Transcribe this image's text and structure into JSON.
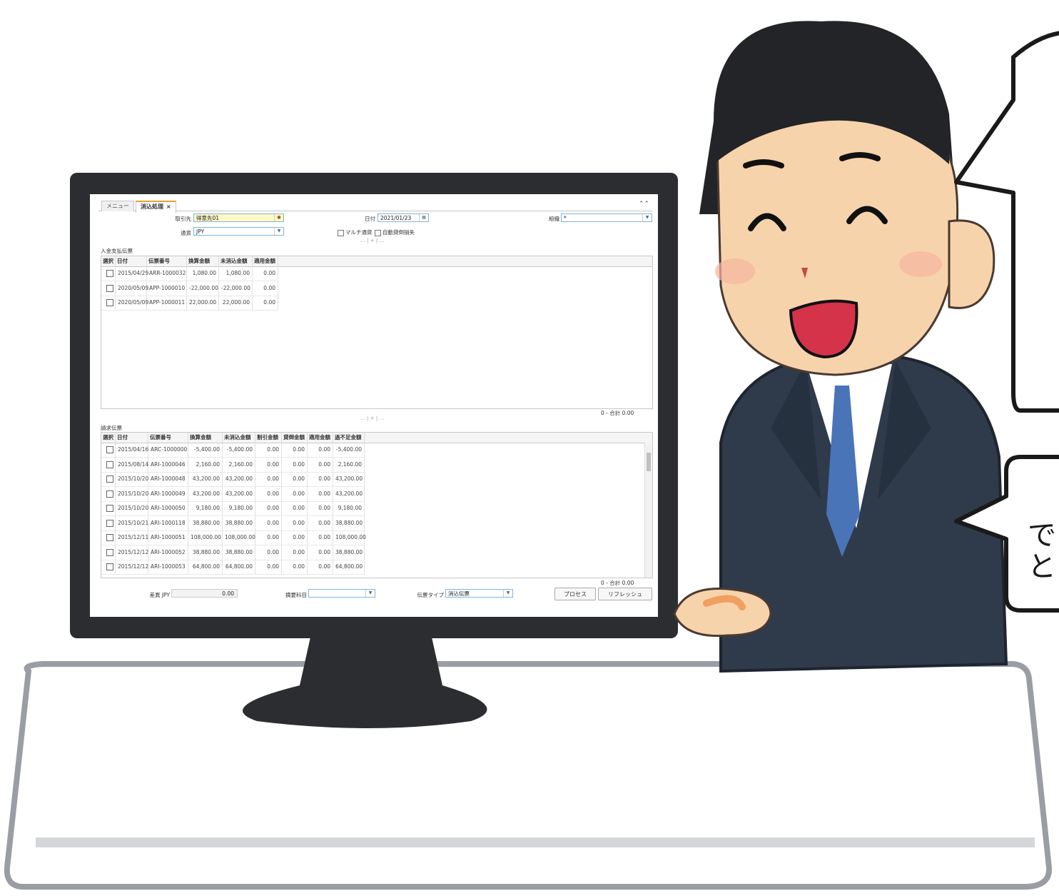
{
  "tabs": [
    {
      "label": "メニュー"
    },
    {
      "label": "消込処理",
      "close": "×"
    }
  ],
  "collapse_icon": "double-chevron-up",
  "form": {
    "partner_label": "取引先",
    "partner_value": "得意先01",
    "currency_label": "通貨",
    "currency_value": "JPY",
    "date_label": "日付",
    "date_value": "2021/01/23",
    "org_label": "組織",
    "org_value": "*",
    "multi_currency_label": "マルチ通貨",
    "auto_writeoff_label": "自動貸倒損失",
    "separator": "… | + | …"
  },
  "payments": {
    "title": "入金支払伝票",
    "columns": [
      "選択",
      "日付",
      "伝票番号",
      "換算金額",
      "未消込金額",
      "適用金額"
    ],
    "rows": [
      [
        "",
        "2015/04/29",
        "ARR-1000032",
        "1,080.00",
        "1,080.00",
        "0.00"
      ],
      [
        "",
        "2020/05/09",
        "APP-1000010",
        "-22,000.00",
        "-22,000.00",
        "0.00"
      ],
      [
        "",
        "2020/05/09",
        "APP-1000011",
        "22,000.00",
        "22,000.00",
        "0.00"
      ]
    ],
    "total": "0 - 合計 0.00"
  },
  "separator2": "… | + | …",
  "invoices": {
    "title": "請求伝票",
    "columns": [
      "選択",
      "日付",
      "伝票番号",
      "換算金額",
      "未消込金額",
      "割引金額",
      "貸倒金額",
      "適用金額",
      "過不足金額"
    ],
    "rows": [
      [
        "",
        "2015/04/16",
        "ARC-1000000",
        "-5,400.00",
        "-5,400.00",
        "0.00",
        "0.00",
        "0.00",
        "-5,400.00"
      ],
      [
        "",
        "2015/08/14",
        "ARI-1000046",
        "2,160.00",
        "2,160.00",
        "0.00",
        "0.00",
        "0.00",
        "2,160.00"
      ],
      [
        "",
        "2015/10/20",
        "ARI-1000048",
        "43,200.00",
        "43,200.00",
        "0.00",
        "0.00",
        "0.00",
        "43,200.00"
      ],
      [
        "",
        "2015/10/20",
        "ARI-1000049",
        "43,200.00",
        "43,200.00",
        "0.00",
        "0.00",
        "0.00",
        "43,200.00"
      ],
      [
        "",
        "2015/10/20",
        "ARI-1000050",
        "9,180.00",
        "9,180.00",
        "0.00",
        "0.00",
        "0.00",
        "9,180.00"
      ],
      [
        "",
        "2015/10/21",
        "ARI-1000118",
        "38,880.00",
        "38,880.00",
        "0.00",
        "0.00",
        "0.00",
        "38,880.00"
      ],
      [
        "",
        "2015/12/11",
        "ARI-1000051",
        "108,000.00",
        "108,000.00",
        "0.00",
        "0.00",
        "0.00",
        "108,000.00"
      ],
      [
        "",
        "2015/12/12",
        "ARI-1000052",
        "38,880.00",
        "38,880.00",
        "0.00",
        "0.00",
        "0.00",
        "38,880.00"
      ],
      [
        "",
        "2015/12/12",
        "ARI-1000053",
        "64,800.00",
        "64,800.00",
        "0.00",
        "0.00",
        "0.00",
        "64,800.00"
      ]
    ],
    "total": "0 - 合計 0.00"
  },
  "footer": {
    "diff_label": "差異 JPY",
    "diff_value": "0.00",
    "summary_label": "摘要科目",
    "summary_value": "",
    "doctype_label": "伝票タイプ",
    "doctype_value": "消込伝票",
    "process_button": "プロセス",
    "refresh_button": "リフレッシュ"
  },
  "bubble2": {
    "line1": "で",
    "line2": "と"
  },
  "colors": {
    "active_tab_accent": "#f0a030",
    "input_border": "#7fb4e0",
    "partner_field_bg": "#fff8c4",
    "monitor": "#2b2d31",
    "suit": "#2f3a4a",
    "tie": "#4a74b8"
  }
}
